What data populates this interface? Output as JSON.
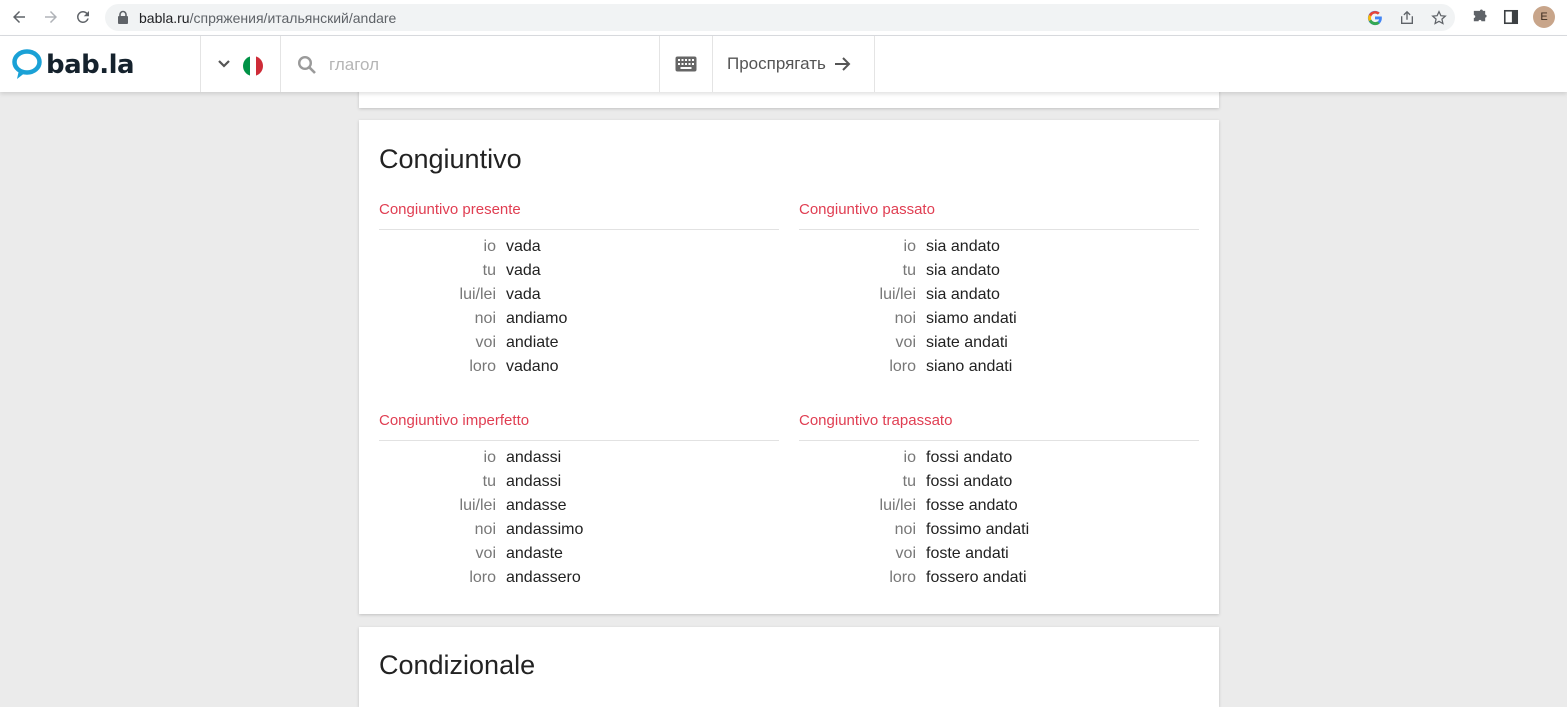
{
  "browser": {
    "url_host": "babla.ru",
    "url_path": "/спряжения/итальянский/andare",
    "avatar_letter": "E"
  },
  "header": {
    "logo_text": "bab.la",
    "search_placeholder": "глагол",
    "conjugate_label": "Проспрягать",
    "flag_colors": [
      "#009246",
      "#ffffff",
      "#ce2b37"
    ]
  },
  "colors": {
    "accent": "#e03e52",
    "logo_blue": "#1aa1d6"
  },
  "congiuntivo": {
    "title": "Congiuntivo",
    "presente": {
      "title": "Congiuntivo presente",
      "rows": [
        {
          "p": "io",
          "f": "vada"
        },
        {
          "p": "tu",
          "f": "vada"
        },
        {
          "p": "lui/lei",
          "f": "vada"
        },
        {
          "p": "noi",
          "f": "andiamo"
        },
        {
          "p": "voi",
          "f": "andiate"
        },
        {
          "p": "loro",
          "f": "vadano"
        }
      ]
    },
    "passato": {
      "title": "Congiuntivo passato",
      "rows": [
        {
          "p": "io",
          "f": "sia andato"
        },
        {
          "p": "tu",
          "f": "sia andato"
        },
        {
          "p": "lui/lei",
          "f": "sia andato"
        },
        {
          "p": "noi",
          "f": "siamo andati"
        },
        {
          "p": "voi",
          "f": "siate andati"
        },
        {
          "p": "loro",
          "f": "siano andati"
        }
      ]
    },
    "imperfetto": {
      "title": "Congiuntivo imperfetto",
      "rows": [
        {
          "p": "io",
          "f": "andassi"
        },
        {
          "p": "tu",
          "f": "andassi"
        },
        {
          "p": "lui/lei",
          "f": "andasse"
        },
        {
          "p": "noi",
          "f": "andassimo"
        },
        {
          "p": "voi",
          "f": "andaste"
        },
        {
          "p": "loro",
          "f": "andassero"
        }
      ]
    },
    "trapassato": {
      "title": "Congiuntivo trapassato",
      "rows": [
        {
          "p": "io",
          "f": "fossi andato"
        },
        {
          "p": "tu",
          "f": "fossi andato"
        },
        {
          "p": "lui/lei",
          "f": "fosse andato"
        },
        {
          "p": "noi",
          "f": "fossimo andati"
        },
        {
          "p": "voi",
          "f": "foste andati"
        },
        {
          "p": "loro",
          "f": "fossero andati"
        }
      ]
    }
  },
  "condizionale": {
    "title": "Condizionale"
  }
}
